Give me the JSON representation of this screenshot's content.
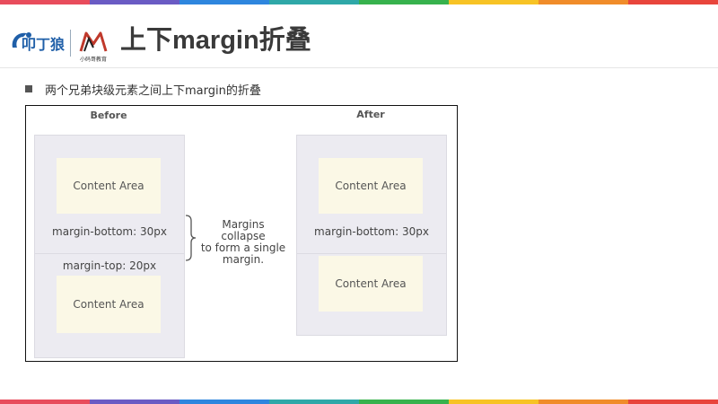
{
  "colors": {
    "stripe": [
      "#e84c5c",
      "#6a5bc4",
      "#2e86de",
      "#2fa8a8",
      "#37b24d",
      "#f7c325",
      "#f08c2a",
      "#e8453c"
    ],
    "accent": "#1f5fa8"
  },
  "header": {
    "title": "上下margin折叠",
    "logo_secondary_text": "小码哥教育"
  },
  "bullet": {
    "text": "两个兄弟块级元素之间上下margin的折叠"
  },
  "figure": {
    "before": {
      "heading": "Before",
      "content_top": "Content Area",
      "margin_bottom": "margin-bottom: 30px",
      "margin_top": "margin-top: 20px",
      "content_bottom": "Content Area"
    },
    "note": {
      "line1": "Margins collapse",
      "line2": "to form a single",
      "line3": "margin."
    },
    "after": {
      "heading": "After",
      "content_top": "Content Area",
      "margin_bottom": "margin-bottom: 30px",
      "content_bottom": "Content Area"
    }
  }
}
